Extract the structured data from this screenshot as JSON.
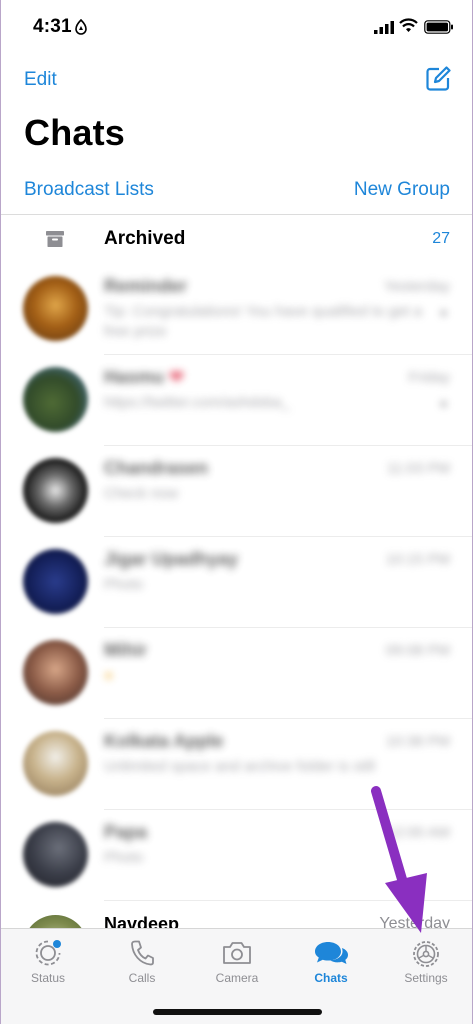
{
  "status_bar": {
    "time": "4:31"
  },
  "header": {
    "edit_label": "Edit",
    "title": "Chats",
    "broadcast_label": "Broadcast Lists",
    "new_group_label": "New Group"
  },
  "archived": {
    "label": "Archived",
    "count": "27"
  },
  "chats": [
    {
      "name": "Reminder",
      "time": "Yesterday",
      "message": "Tip: Congratulations! You have qualified to get a free prize"
    },
    {
      "name": "Hasmu",
      "time": "Friday",
      "message": "https://twitter.com/ashdsba_"
    },
    {
      "name": "Chandrasen",
      "time": "11:03 PM",
      "message": "Check now"
    },
    {
      "name": "Jigar Upadhyay",
      "time": "10:15 PM",
      "message": "Photo"
    },
    {
      "name": "Mihir",
      "time": "09:08 PM",
      "message": ""
    },
    {
      "name": "Kolkata Apple",
      "time": "10:38 PM",
      "message": "Unlimited space and archive folder is still"
    },
    {
      "name": "Papa",
      "time": "12:00 AM",
      "message": "Photo"
    }
  ],
  "last_chat": {
    "name": "Navdeep",
    "time": "Yesterday"
  },
  "tabs": [
    {
      "label": "Status",
      "icon": "status-icon"
    },
    {
      "label": "Calls",
      "icon": "phone-icon"
    },
    {
      "label": "Camera",
      "icon": "camera-icon"
    },
    {
      "label": "Chats",
      "icon": "chats-icon",
      "active": true
    },
    {
      "label": "Settings",
      "icon": "gear-icon"
    }
  ],
  "colors": {
    "accent": "#1e86d9",
    "annotation_arrow": "#8a2fc0"
  }
}
